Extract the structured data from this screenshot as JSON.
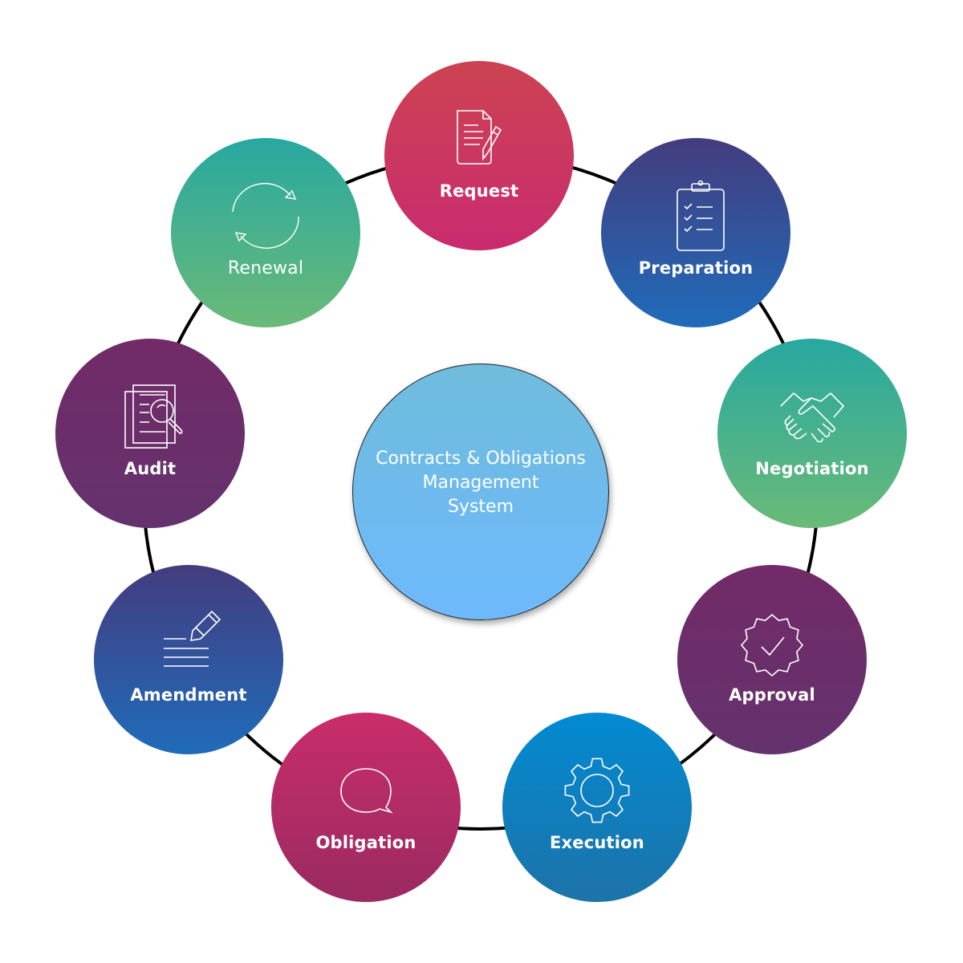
{
  "center": {
    "lines": [
      "Contracts & Obligations",
      "Management",
      "System"
    ],
    "gradient": [
      "#6fbcdc",
      "#6db9fd"
    ]
  },
  "stages": [
    {
      "label": "Request",
      "icon": "document-pen-icon",
      "gradient": [
        "#cd4351",
        "#c92b6f"
      ]
    },
    {
      "label": "Preparation",
      "icon": "clipboard-checklist-icon",
      "gradient": [
        "#443c7e",
        "#1f6cba"
      ]
    },
    {
      "label": "Negotiation",
      "icon": "handshake-icon",
      "gradient": [
        "#27a8a0",
        "#6aba78"
      ]
    },
    {
      "label": "Approval",
      "icon": "badge-check-icon",
      "gradient": [
        "#722b68",
        "#64326d"
      ]
    },
    {
      "label": "Execution",
      "icon": "gear-icon",
      "gradient": [
        "#028ad2",
        "#1d73a8"
      ]
    },
    {
      "label": "Obligation",
      "icon": "speech-bubble-icon",
      "gradient": [
        "#c92d6a",
        "#9a2a61"
      ]
    },
    {
      "label": "Amendment",
      "icon": "pencil-lines-icon",
      "gradient": [
        "#443c7e",
        "#1f6cba"
      ]
    },
    {
      "label": "Audit",
      "icon": "document-search-icon",
      "gradient": [
        "#722b68",
        "#64326d"
      ]
    },
    {
      "label": "Renewal",
      "icon": "refresh-cycle-icon",
      "gradient": [
        "#27a8a0",
        "#6aba78"
      ]
    }
  ],
  "ring_color": "#000000"
}
